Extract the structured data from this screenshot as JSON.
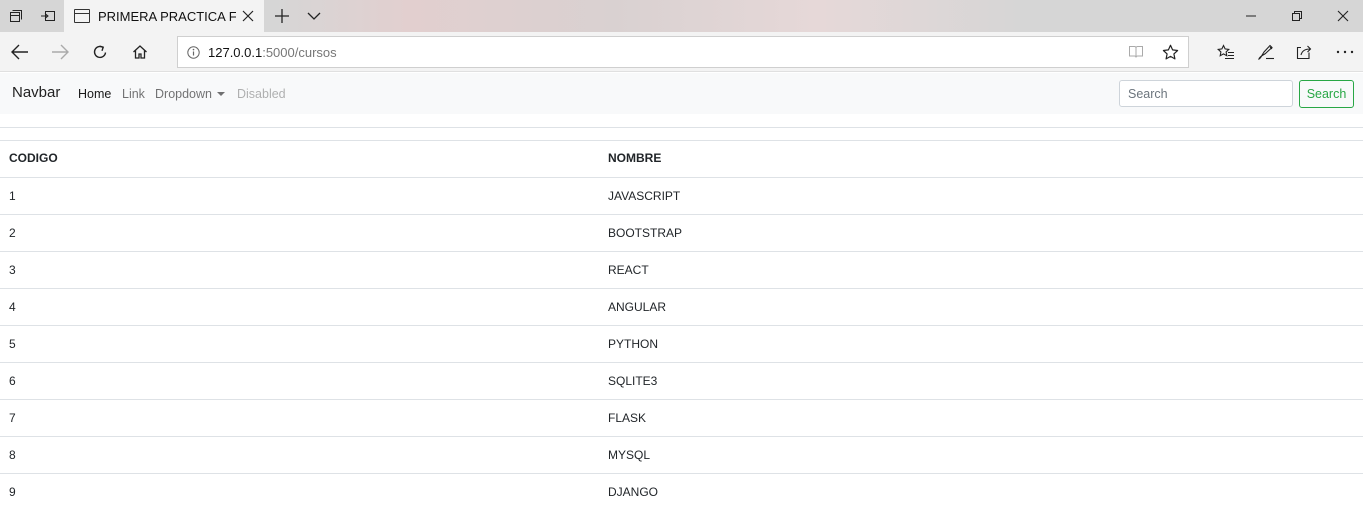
{
  "browser": {
    "tab_title": "PRIMERA PRACTICA FLA",
    "url_host": "127.0.0.1",
    "url_path": ":5000/cursos",
    "icons": {
      "tab_actions": "tab-actions-icon",
      "set_aside": "set-aside-tabs-icon",
      "tab_page": "page-icon",
      "tab_close": "close-icon",
      "new_tab": "plus-icon",
      "tab_list": "chevron-down-icon",
      "minimize": "minimize-icon",
      "restore": "restore-icon",
      "close_window": "close-icon",
      "back": "back-arrow-icon",
      "forward": "forward-arrow-icon",
      "refresh": "refresh-icon",
      "home": "home-icon",
      "info": "info-icon",
      "reading_view": "reading-view-icon",
      "favorite": "star-icon",
      "favorites_hub": "favorites-hub-icon",
      "notes": "pen-icon",
      "share": "share-icon",
      "more": "more-icon"
    }
  },
  "navbar": {
    "brand": "Navbar",
    "links": {
      "home": "Home",
      "link": "Link",
      "dropdown": "Dropdown",
      "disabled": "Disabled"
    },
    "search_placeholder": "Search",
    "search_button": "Search",
    "colors": {
      "success": "#28a745",
      "background": "#f8f9fa"
    }
  },
  "table": {
    "headers": [
      "CODIGO",
      "NOMBRE"
    ],
    "rows": [
      [
        "1",
        "JAVASCRIPT"
      ],
      [
        "2",
        "BOOTSTRAP"
      ],
      [
        "3",
        "REACT"
      ],
      [
        "4",
        "ANGULAR"
      ],
      [
        "5",
        "PYTHON"
      ],
      [
        "6",
        "SQLITE3"
      ],
      [
        "7",
        "FLASK"
      ],
      [
        "8",
        "MYSQL"
      ],
      [
        "9",
        "DJANGO"
      ]
    ]
  }
}
